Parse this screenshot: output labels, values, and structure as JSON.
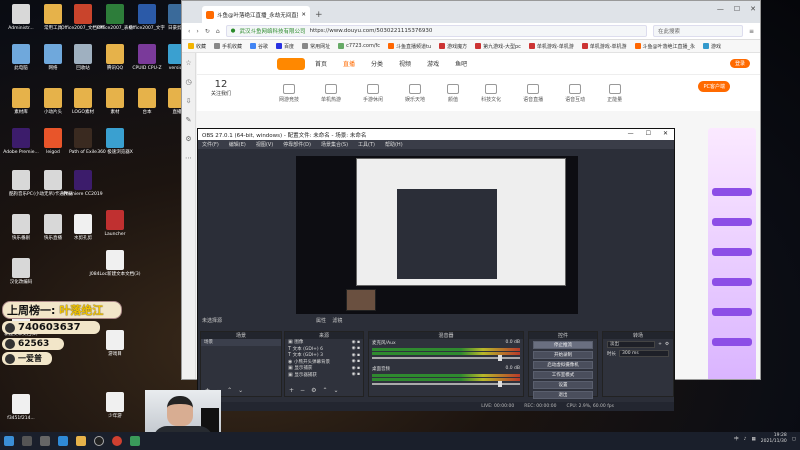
{
  "desktop": {
    "icons_col1": [
      {
        "label": "Administr...",
        "color": "#d8d8d8"
      },
      {
        "label": "此电脑",
        "color": "#6fa8dc"
      },
      {
        "label": "素材库",
        "color": "#e6b24a"
      },
      {
        "label": "Adobe Premie...",
        "color": "#3c1c6b"
      },
      {
        "label": "酷狗音乐PC",
        "color": "#d8d8d8"
      },
      {
        "label": "快乐番剧",
        "color": "#d8d8d8"
      },
      {
        "label": "汉化改编码",
        "color": "#d8d8d8"
      },
      {
        "label": "新建文本文档(2)",
        "color": "#f0f0f0"
      },
      {
        "label": "f3451f214...",
        "color": "#f0f0f0"
      }
    ],
    "icons_col2": [
      {
        "label": "常用工具",
        "color": "#e6b24a"
      },
      {
        "label": "网络",
        "color": "#6fa8dc"
      },
      {
        "label": "小动片头",
        "color": "#e6b24a"
      },
      {
        "label": "leigod",
        "color": "#e8552a"
      },
      {
        "label": "(小动无吊)卡通预览",
        "color": "#d8d8d8"
      },
      {
        "label": "快乐直播",
        "color": "#d8d8d8"
      }
    ],
    "icons_col3": [
      {
        "label": "Office2007_文档PPT",
        "color": "#c9442c"
      },
      {
        "label": "回收站",
        "color": "#9fb0c0"
      },
      {
        "label": "LOGO素材",
        "color": "#e6b24a"
      },
      {
        "label": "Path of Exile",
        "color": "#3a2a20"
      },
      {
        "label": "Premiere CC2019",
        "color": "#3c1c6b"
      },
      {
        "label": "水剪孔剪",
        "color": "#f0f0f0"
      }
    ],
    "icons_col4": [
      {
        "label": "Office2007_表格",
        "color": "#2d7d3a"
      },
      {
        "label": "腾讯QQ",
        "color": "#e6b24a"
      },
      {
        "label": "素材",
        "color": "#e6b24a"
      },
      {
        "label": "360 极速浏览器X",
        "color": "#3aa0d0"
      },
      {
        "label": "Launcher",
        "color": "#c03030"
      },
      {
        "label": "J084Loc新建文本文档(3)",
        "color": "#f0f0f0"
      },
      {
        "label": "游戏目",
        "color": "#f0f0f0"
      },
      {
        "label": "少年游",
        "color": "#f0f0f0"
      }
    ],
    "icons_col5": [
      {
        "label": "Office2007_文字",
        "color": "#2b5aa8"
      },
      {
        "label": "CPUID CPU-Z",
        "color": "#7a3a9a"
      },
      {
        "label": "台本",
        "color": "#e6b24a"
      }
    ],
    "icons_col6": [
      {
        "label": "日豪剪辑",
        "color": "#3a6a9a"
      },
      {
        "label": "version",
        "color": "#3aa0d0"
      },
      {
        "label": "直播",
        "color": "#e6b24a"
      }
    ]
  },
  "browser": {
    "tab_title": "斗鱼@叶落绝江直播_永劫无间直播_斗鱼",
    "site_name": "武汉斗鱼网络科技有限公司",
    "url": "https://www.douyu.com/5030221115376930",
    "search_placeholder": "在此搜索",
    "bookmarks": [
      "收藏",
      "手机收藏",
      "谷歌",
      "百度",
      "常用网址",
      "c7723.com/fc",
      "斗鱼直播频道tu",
      "游戏魔方",
      "第九游戏-大型pc",
      "单机游戏-单机游",
      "单机游戏-单机游",
      "斗鱼@叶落绝江直播_永",
      "游戏"
    ],
    "nav": [
      "首页",
      "直播",
      "分类",
      "视频",
      "游戏",
      "鱼吧"
    ],
    "nav_active": "直播",
    "login": "登录",
    "day": "12",
    "day_label": "关注我们",
    "categories": [
      "网游竞技",
      "单机热游",
      "手游休闲",
      "娱乐天地",
      "颜值",
      "科技文化",
      "语音直播",
      "语音互动",
      "正能量"
    ],
    "pc_button": "PC客户端"
  },
  "obs": {
    "title": "OBS 27.0.1 (64-bit, windows) - 配置文件: 未命名 - 场景: 未命名",
    "menu": [
      "文件(F)",
      "编辑(E)",
      "视图(V)",
      "停靠部件(D)",
      "场景集合(S)",
      "工具(T)",
      "帮助(H)"
    ],
    "selection_label": "未选择源",
    "filter_labels": [
      "属性",
      "滤镜"
    ],
    "docks": {
      "scenes": "场景",
      "sources": "来源",
      "mixer": "混音器",
      "transitions": "转场",
      "controls": "控件"
    },
    "scene_item": "场景",
    "sources": [
      {
        "icon": "▣",
        "label": "图像"
      },
      {
        "icon": "T",
        "label": "文本 (GDI+) 6"
      },
      {
        "icon": "T",
        "label": "文本 (GDI+) 3"
      },
      {
        "icon": "◉",
        "label": "小熊开头弹幕背景"
      },
      {
        "icon": "▣",
        "label": "显示捕获"
      },
      {
        "icon": "▣",
        "label": "显示器捕获"
      }
    ],
    "mixer": [
      {
        "name": "麦克风/Aux",
        "db": "0.0 dB"
      },
      {
        "name": "桌面音频",
        "db": "0.0 dB"
      }
    ],
    "controls": [
      "停止推流",
      "开始录制",
      "启动虚拟摄像机",
      "工作室模式",
      "设置",
      "退出"
    ],
    "controls_active": "停止推流",
    "transition_type": "淡出",
    "transition_duration_label": "时长",
    "transition_duration": "300 ms",
    "status": [
      "LIVE: 00:00:00",
      "REC: 00:00:00",
      "CPU: 2.9%, 60.00 fps"
    ]
  },
  "overlay": {
    "line1_prefix": "上周榜一:",
    "line1_name": "叶落绝江",
    "line2": "740603637",
    "line3": "62563",
    "line4": "一爱普"
  },
  "taskbar": {
    "time": "19:28",
    "date": "2021/11/30",
    "lang": "中"
  }
}
